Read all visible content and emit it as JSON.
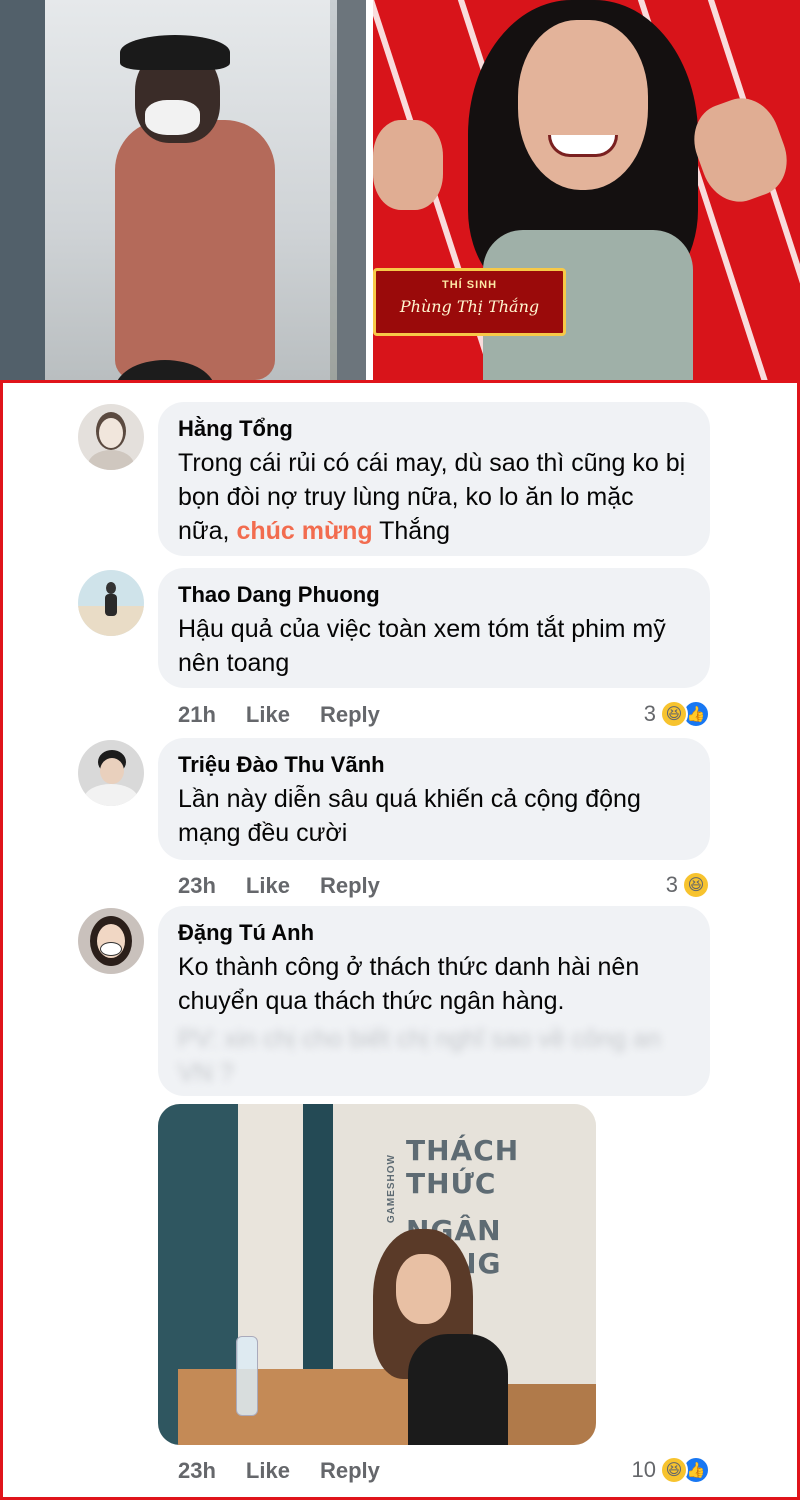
{
  "header_images": {
    "right_plate": {
      "role": "THÍ SINH",
      "name": "Phùng Thị Thắng"
    }
  },
  "comments": [
    {
      "author": "Hằng Tổng",
      "text_before": "Trong cái rủi có cái may, dù sao thì cũng ko bị bọn đòi nợ truy lùng nữa, ko lo ăn lo mặc nữa,",
      "highlight": "chúc mừng",
      "text_after": "Thắng"
    },
    {
      "author": "Thao Dang Phuong",
      "text": "Hậu quả của việc toàn xem tóm tắt phim mỹ nên toang",
      "time": "21h",
      "like": "Like",
      "reply": "Reply",
      "reaction_count": "3"
    },
    {
      "author": "Triệu Đào Thu Vãnh",
      "text": "Lần này diễn sâu quá khiến cả cộng động mạng đều cười",
      "time": "23h",
      "like": "Like",
      "reply": "Reply",
      "reaction_count": "3"
    },
    {
      "author": "Đặng Tú Anh",
      "text": "Ko thành công ở thách thức danh hài nên chuyển qua thách thức ngân hàng.",
      "blurred_text": "PV: xin chị cho biết chị nghĩ sao về công an VN ?",
      "time": "23h",
      "like": "Like",
      "reply": "Reply",
      "reaction_count": "10",
      "attachment": {
        "sign_small": "GAMESHOW",
        "sign_line1": "THÁCH THỨC",
        "sign_line2": "NGÂN HÀNG"
      }
    }
  ],
  "colors": {
    "frame": "#e0141b",
    "bubble": "#f0f2f5",
    "highlight": "#f26c4f",
    "meta": "#65676b",
    "like_blue": "#1877f2"
  },
  "icons": [
    "haha-reaction-icon",
    "like-reaction-icon"
  ]
}
